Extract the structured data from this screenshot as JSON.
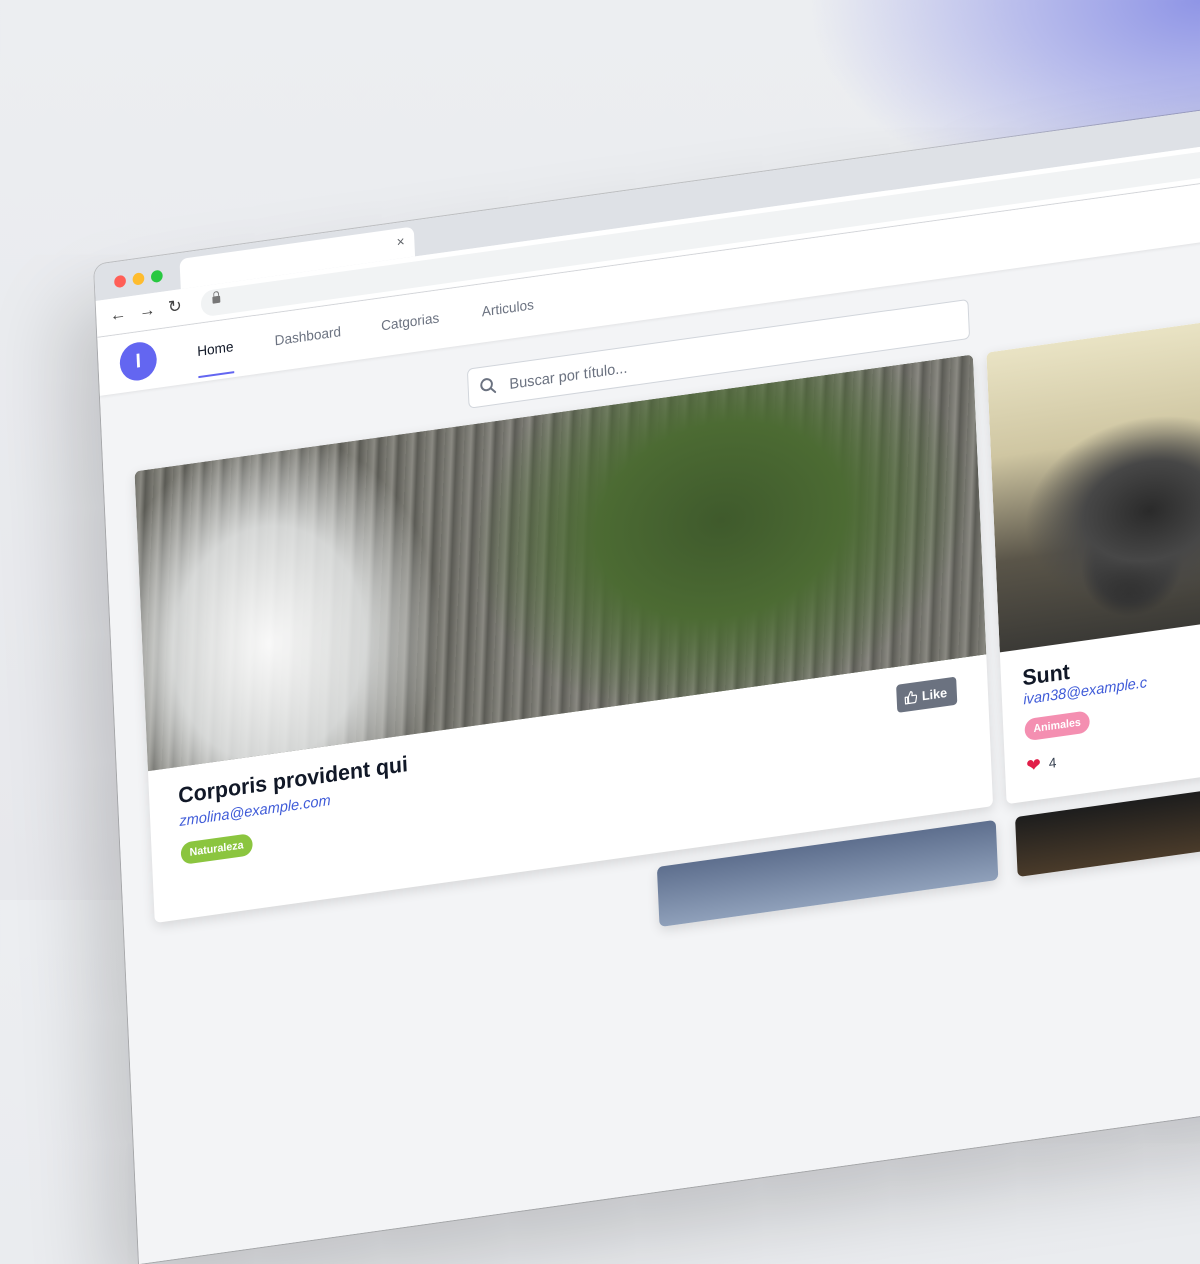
{
  "browser": {
    "tab": {
      "close_glyph": "×"
    },
    "nav": {
      "back": "←",
      "forward": "→",
      "reload": "↻"
    }
  },
  "app": {
    "logo_letter": "I",
    "nav_links": [
      "Home",
      "Dashboard",
      "Catgorias",
      "Articulos"
    ],
    "active_link": "Home",
    "search": {
      "placeholder": "Buscar por título..."
    }
  },
  "cards": [
    {
      "title": "Corporis provident qui",
      "email": "zmolina@example.com",
      "tag": "Naturaleza",
      "tag_color": "#8bc53f",
      "like_label": "Like"
    },
    {
      "title": "Sunt",
      "email": "ivan38@example.c",
      "tag": "Animales",
      "tag_color": "#f48fb1",
      "likes_count": "4"
    }
  ],
  "colors": {
    "accent": "#6366f1",
    "link": "#3f5bd8",
    "like_button": "#6b7280",
    "heart": "#e11d48"
  }
}
